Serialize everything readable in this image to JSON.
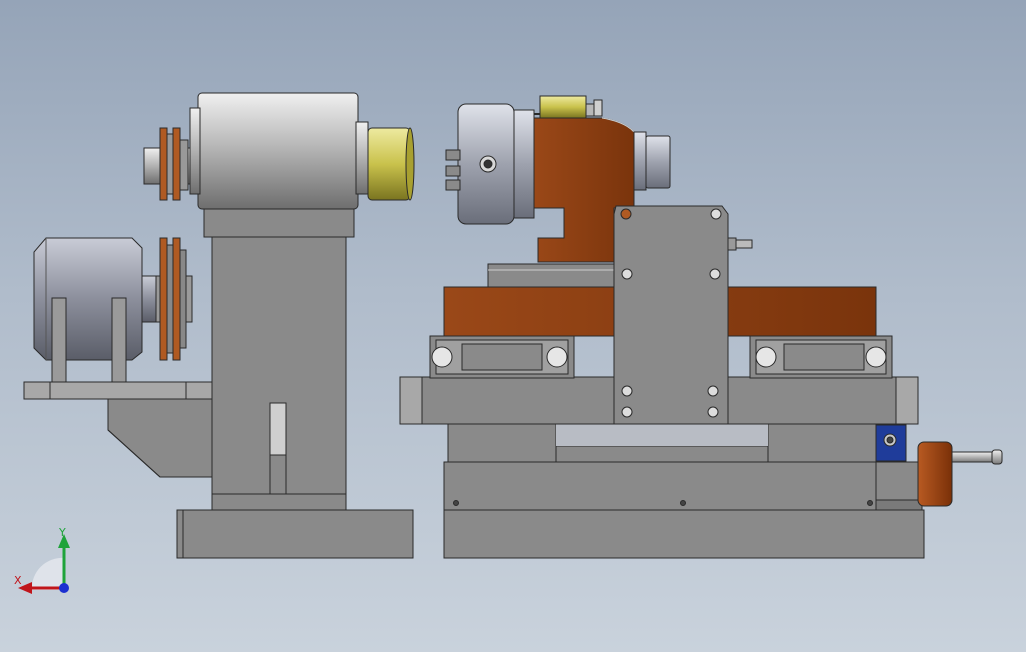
{
  "colors": {
    "background_top": "#95a4b8",
    "background_bottom": "#c9d2dc",
    "gray_part": "#8a8a8a",
    "light_gray_part": "#b4b4b4",
    "rust_part": "#8a3d12",
    "brass_part": "#b7b43a",
    "blue_part": "#1f3c9a",
    "outline": "#2a2a2a",
    "axis_x": "#c0151b",
    "axis_y": "#1ea33a",
    "axis_z": "#1b2fd0"
  },
  "triad": {
    "x_label": "X",
    "y_label": "Y"
  }
}
